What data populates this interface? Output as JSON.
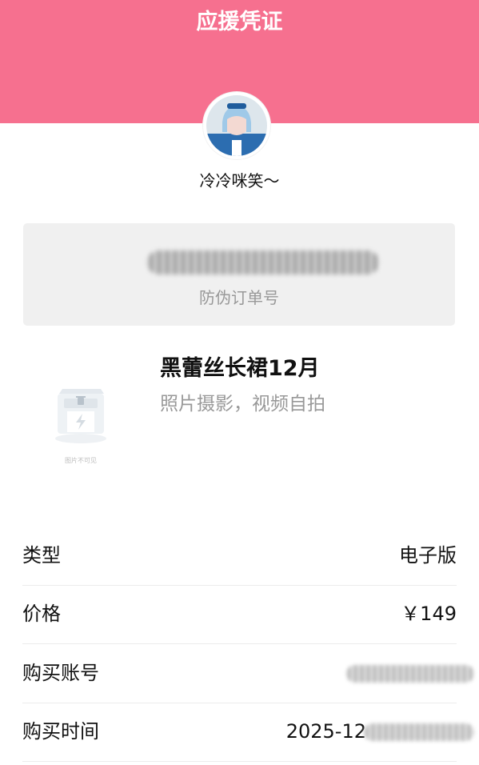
{
  "header": {
    "title": "应援凭证"
  },
  "user": {
    "name": "冷冷咪笑～"
  },
  "order": {
    "label": "防伪订单号"
  },
  "product": {
    "title": "黑蕾丝长裙12月",
    "subtitle": "照片摄影，视频自拍",
    "image_caption": "图片不可见"
  },
  "details": {
    "type_label": "类型",
    "type_value": "电子版",
    "price_label": "价格",
    "price_value": "￥149",
    "account_label": "购买账号",
    "time_label": "购买时间",
    "time_value": "2025-12"
  },
  "colors": {
    "accent": "#f6708f",
    "card_bg": "#f0f0f0",
    "muted_text": "#999999"
  }
}
